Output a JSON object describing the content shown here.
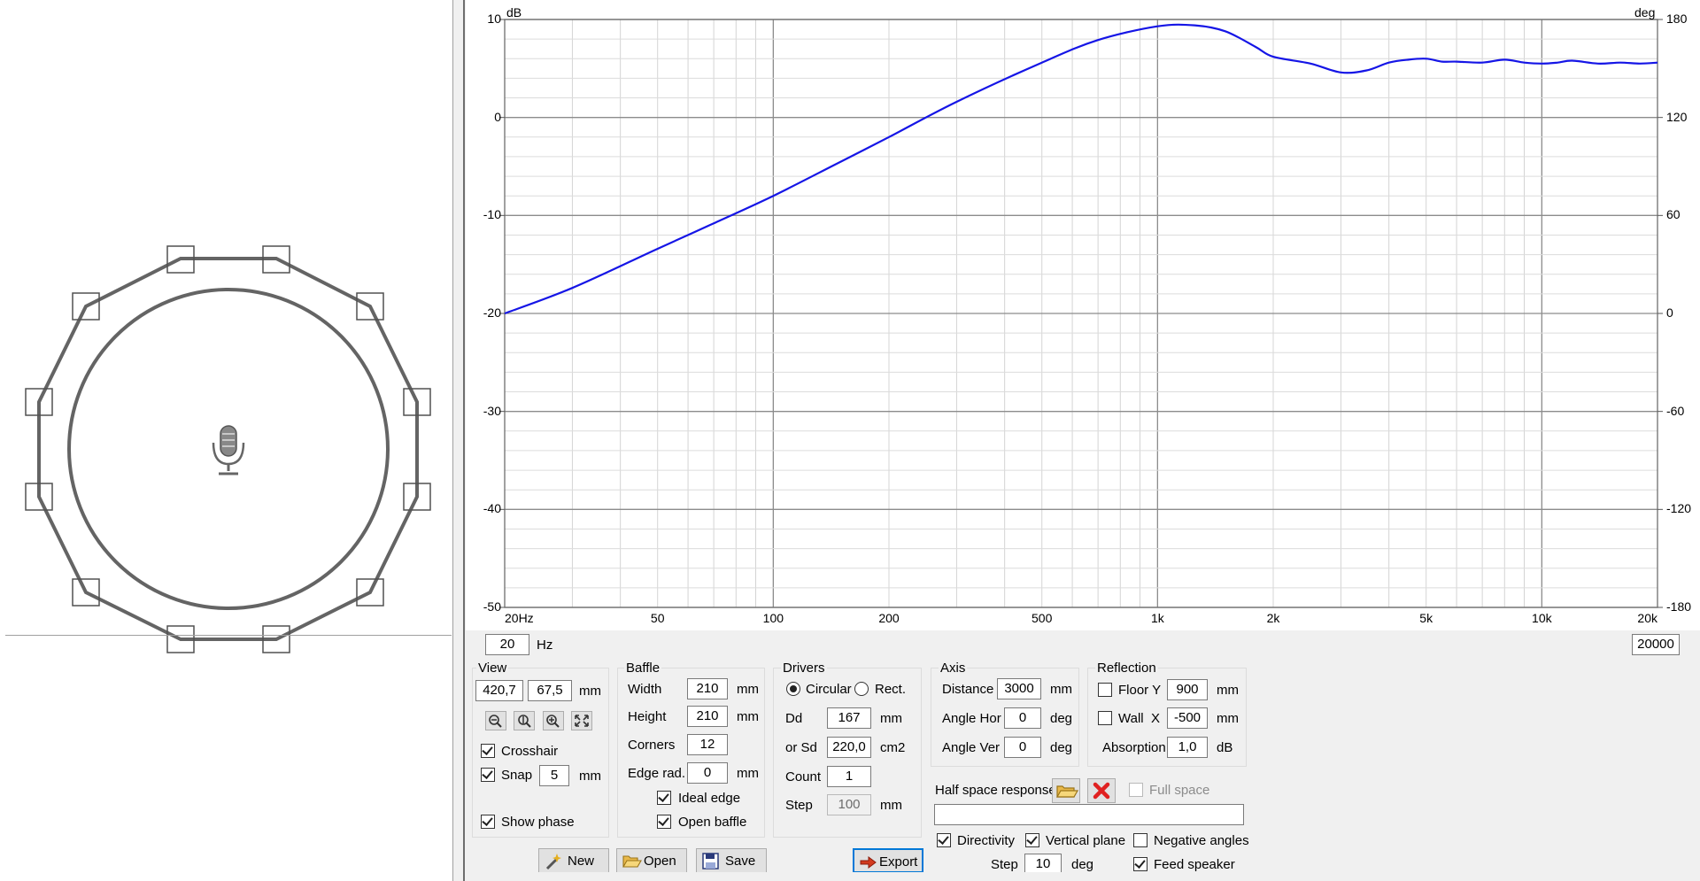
{
  "view_panel": {
    "mic_icon": "microphone-icon",
    "corner_count": 12
  },
  "graph": {
    "y_unit_left": "dB",
    "y_unit_right": "deg",
    "y_left_ticks": [
      "10",
      "0",
      "-10",
      "-20",
      "-30",
      "-40",
      "-50"
    ],
    "y_right_ticks": [
      "180",
      "120",
      "60",
      "0",
      "-60",
      "-120",
      "-180"
    ],
    "x_ticks": [
      "20Hz",
      "50",
      "100",
      "200",
      "500",
      "1k",
      "2k",
      "5k",
      "10k",
      "20k"
    ],
    "line_color": "#1515e6",
    "grid": true
  },
  "chart_data": {
    "type": "line",
    "x_scale": "log",
    "xlim": [
      20,
      20000
    ],
    "ylim": [
      -50,
      10
    ],
    "y2lim": [
      -180,
      180
    ],
    "x": [
      20,
      30,
      50,
      70,
      100,
      150,
      200,
      300,
      500,
      700,
      1000,
      1250,
      1500,
      1800,
      2000,
      2500,
      3000,
      3500,
      4000,
      4500,
      5000,
      5500,
      6000,
      7000,
      8000,
      9000,
      10000,
      11000,
      12000,
      14000,
      16000,
      18000,
      20000
    ],
    "series": [
      {
        "values": [
          -20,
          -17.4,
          -13.4,
          -10.8,
          -8,
          -4.5,
          -2,
          1.6,
          5.6,
          7.9,
          9.3,
          9.4,
          8.8,
          7.2,
          6.2,
          5.5,
          4.6,
          4.8,
          5.6,
          5.9,
          6.0,
          5.7,
          5.7,
          5.6,
          5.9,
          5.6,
          5.5,
          5.6,
          5.8,
          5.5,
          5.6,
          5.5,
          5.6
        ]
      }
    ]
  },
  "freq_min": {
    "value": "20",
    "unit": "Hz"
  },
  "freq_max": {
    "value": "20000"
  },
  "view": {
    "title": "View",
    "x": "420,7",
    "y": "67,5",
    "unit": "mm",
    "crosshair_label": "Crosshair",
    "crosshair_checked": true,
    "snap_label": "Snap",
    "snap_checked": true,
    "snap_value": "5",
    "snap_unit": "mm",
    "show_phase_label": "Show phase",
    "show_phase_checked": true,
    "zoom_icons": [
      "zoom-out-icon",
      "zoom-vertical-icon",
      "zoom-in-icon",
      "fit-icon"
    ]
  },
  "baffle": {
    "title": "Baffle",
    "width_label": "Width",
    "width": "210",
    "width_unit": "mm",
    "height_label": "Height",
    "height": "210",
    "height_unit": "mm",
    "corners_label": "Corners",
    "corners": "12",
    "edge_label": "Edge rad.",
    "edge": "0",
    "edge_unit": "mm",
    "ideal_edge_label": "Ideal edge",
    "ideal_edge_checked": true,
    "open_baffle_label": "Open baffle",
    "open_baffle_checked": true
  },
  "drivers": {
    "title": "Drivers",
    "circular_label": "Circular",
    "rect_label": "Rect.",
    "dd_label": "Dd",
    "dd": "167",
    "dd_unit": "mm",
    "sd_label": "or Sd",
    "sd": "220,0",
    "sd_unit": "cm2",
    "count_label": "Count",
    "count": "1",
    "step_label": "Step",
    "step": "100",
    "step_unit": "mm"
  },
  "axis": {
    "title": "Axis",
    "distance_label": "Distance",
    "distance": "3000",
    "distance_unit": "mm",
    "hor_label": "Angle Hor",
    "hor": "0",
    "hor_unit": "deg",
    "ver_label": "Angle Ver",
    "ver": "0",
    "ver_unit": "deg"
  },
  "reflection": {
    "title": "Reflection",
    "floor_label": "Floor Y",
    "floor": "900",
    "floor_unit": "mm",
    "wall_label": "Wall  X",
    "wall": "-500",
    "wall_unit": "mm",
    "absorption_label": "Absorption",
    "absorption": "1,0",
    "absorption_unit": "dB"
  },
  "half_space": {
    "label": "Half space response",
    "full_space_label": "Full space",
    "path": "",
    "open_icon": "folder-open-icon",
    "delete_icon": "red-x-icon"
  },
  "polar": {
    "directivity_label": "Directivity",
    "vertical_label": "Vertical plane",
    "negative_label": "Negative angles",
    "step_label": "Step",
    "step": "10",
    "step_unit": "deg",
    "feed_label": "Feed speaker"
  },
  "buttons": {
    "new_label": "New",
    "open_label": "Open",
    "save_label": "Save",
    "export_label": "Export"
  }
}
